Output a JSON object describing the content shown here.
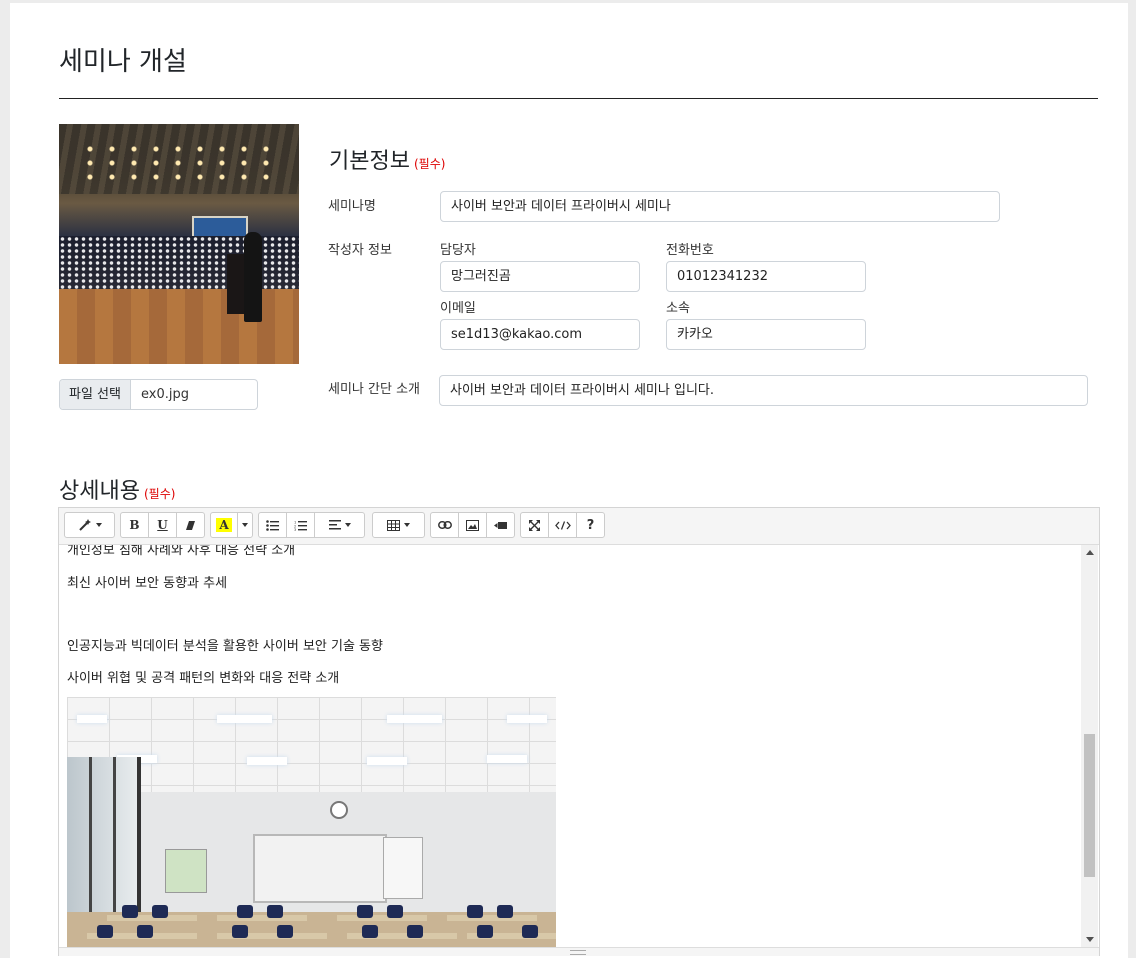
{
  "page": {
    "title": "세미나 개설",
    "file_button": "파일 선택",
    "file_name": "ex0.jpg"
  },
  "basic": {
    "title": "기본정보",
    "required": "(필수)",
    "seminar_name_label": "세미나명",
    "seminar_name_value": "사이버 보안과 데이터 프라이버시 세미나",
    "author_label": "작성자 정보",
    "manager_label": "담당자",
    "manager_value": "망그러진곰",
    "phone_label": "전화번호",
    "phone_value": "01012341232",
    "email_label": "이메일",
    "email_value": "se1d13@kakao.com",
    "org_label": "소속",
    "org_value": "카카오",
    "intro_label": "세미나 간단 소개",
    "intro_value": "사이버 보안과 데이터 프라이버시 세미나 입니다."
  },
  "detail": {
    "title": "상세내용",
    "required": "(필수)",
    "toolbar": {
      "bold": "B",
      "underline": "U",
      "highlight": "A",
      "help": "?"
    },
    "lines": [
      "개인정보 침해 사례와 사후 대응 전략 소개",
      "최신 사이버 보안 동향과 추세",
      "인공지능과 빅데이터 분석을 활용한 사이버 보안 기술 동향",
      "사이버 위협 및 공격 패턴의 변화와 대응 전략 소개"
    ]
  },
  "icons": {
    "magic": "magic-wand-icon",
    "eraser": "eraser-icon",
    "ul": "unordered-list-icon",
    "ol": "ordered-list-icon",
    "align": "align-icon",
    "table": "table-icon",
    "link": "link-icon",
    "picture": "picture-icon",
    "video": "video-icon",
    "fullscreen": "fullscreen-icon",
    "code": "code-view-icon"
  },
  "colors": {
    "required": "#dd0000",
    "highlight": "#ffff00"
  }
}
